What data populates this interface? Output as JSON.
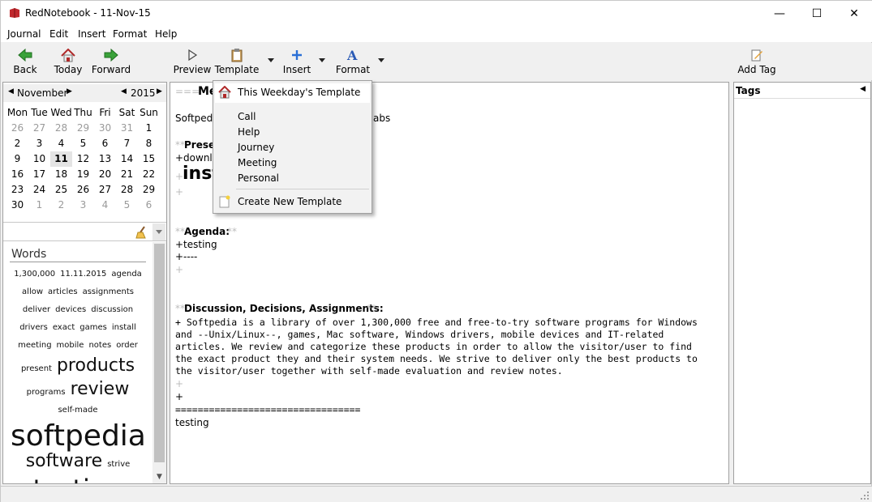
{
  "window": {
    "title": "RedNotebook - 11-Nov-15",
    "minimize_icon": "—",
    "maximize_icon": "☐",
    "close_icon": "✕"
  },
  "menu": [
    "Journal",
    "Edit",
    "Insert",
    "Format",
    "Help"
  ],
  "nav_toolbar": {
    "back": "Back",
    "today": "Today",
    "forward": "Forward"
  },
  "edit_toolbar": {
    "preview": "Preview",
    "template": "Template",
    "insert": "Insert",
    "format": "Format"
  },
  "tag_toolbar": {
    "add_tag": "Add Tag"
  },
  "calendar": {
    "month": "November",
    "year": "2015",
    "weekdays": [
      "Mon",
      "Tue",
      "Wed",
      "Thu",
      "Fri",
      "Sat",
      "Sun"
    ],
    "weeks": [
      [
        [
          "26",
          1
        ],
        [
          "27",
          1
        ],
        [
          "28",
          1
        ],
        [
          "29",
          1
        ],
        [
          "30",
          1
        ],
        [
          "31",
          1
        ],
        [
          "1",
          0
        ]
      ],
      [
        [
          "2",
          0
        ],
        [
          "3",
          0
        ],
        [
          "4",
          0
        ],
        [
          "5",
          0
        ],
        [
          "6",
          0
        ],
        [
          "7",
          0
        ],
        [
          "8",
          0
        ]
      ],
      [
        [
          "9",
          0
        ],
        [
          "10",
          0
        ],
        [
          "11",
          2
        ],
        [
          "12",
          0
        ],
        [
          "13",
          0
        ],
        [
          "14",
          0
        ],
        [
          "15",
          0
        ]
      ],
      [
        [
          "16",
          0
        ],
        [
          "17",
          0
        ],
        [
          "18",
          0
        ],
        [
          "19",
          0
        ],
        [
          "20",
          0
        ],
        [
          "21",
          0
        ],
        [
          "22",
          0
        ]
      ],
      [
        [
          "23",
          0
        ],
        [
          "24",
          0
        ],
        [
          "25",
          0
        ],
        [
          "26",
          0
        ],
        [
          "27",
          0
        ],
        [
          "28",
          0
        ],
        [
          "29",
          0
        ]
      ],
      [
        [
          "30",
          0
        ],
        [
          "1",
          1
        ],
        [
          "2",
          1
        ],
        [
          "3",
          1
        ],
        [
          "4",
          1
        ],
        [
          "5",
          1
        ],
        [
          "6",
          1
        ]
      ]
    ]
  },
  "words_panel": {
    "title": "Words",
    "cloud": [
      [
        "1,300,000",
        10
      ],
      [
        "11.11.2015",
        10
      ],
      [
        "agenda",
        10
      ],
      [
        "allow",
        10
      ],
      [
        "articles",
        10
      ],
      [
        "assignments",
        10
      ],
      [
        "deliver",
        10
      ],
      [
        "devices",
        10
      ],
      [
        "discussion",
        10
      ],
      [
        "drivers",
        10
      ],
      [
        "exact",
        10
      ],
      [
        "games",
        10
      ],
      [
        "install",
        10
      ],
      [
        "meeting",
        10
      ],
      [
        "mobile",
        10
      ],
      [
        "notes",
        10
      ],
      [
        "order",
        10
      ],
      [
        "present",
        10
      ],
      [
        "products",
        22
      ],
      [
        "programs",
        10
      ],
      [
        "review",
        22
      ],
      [
        "self-made",
        10
      ],
      [
        "softpedia",
        36
      ],
      [
        "software",
        22
      ],
      [
        "strive",
        10
      ],
      [
        "testing",
        32
      ]
    ]
  },
  "editor": {
    "title_prefix": "=== ",
    "title": "Me",
    "line_softpedia": "Softpedia",
    "line_softpedia_tail": "abs",
    "presenters_marker": "**",
    "presenters": "Prese",
    "download": "+downlo",
    "install_plus": "+",
    "install": "inst",
    "plus": "+",
    "agenda": "Agenda:",
    "testing_line": "+testing",
    "dashes": "+----",
    "discussion": "Discussion, Decisions, Assignments:",
    "paragraph": [
      "+ Softpedia is a library of over 1,300,000 free and free-to-try software programs for Windows",
      "and --Unix/Linux--, games, Mac software, Windows drivers, mobile devices and IT-related",
      "articles. We review and categorize these products in order to allow the visitor/user to find",
      "the exact product they and their system needs. We strive to deliver only the best products to",
      "the visitor/user together with self-made evaluation and review notes."
    ],
    "equals": "=================================",
    "testing": "testing"
  },
  "tags_panel": {
    "title": "Tags"
  },
  "template_menu": {
    "weekday": "This Weekday's Template",
    "items": [
      "Call",
      "Help",
      "Journey",
      "Meeting",
      "Personal"
    ],
    "create": "Create New Template"
  },
  "colors": {
    "accent": "#cce8ff",
    "menu_bg": "#f2f2f2"
  }
}
